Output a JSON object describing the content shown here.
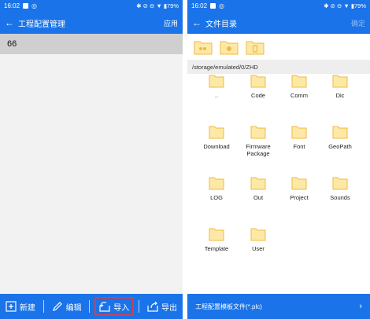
{
  "left": {
    "status": {
      "time": "16:02",
      "right": "✱ ⊘ ⊖ ▼ ▮79%"
    },
    "appbar": {
      "title": "工程配置管理",
      "action": "应用"
    },
    "projects": [
      {
        "name": "66"
      }
    ],
    "toolbar": {
      "new": "新建",
      "edit": "编辑",
      "import": "导入",
      "export": "导出"
    }
  },
  "right": {
    "status": {
      "time": "16:02",
      "right": "✱ ⊘ ⊖ ▼ ▮79%"
    },
    "appbar": {
      "title": "文件目录",
      "action": "确定"
    },
    "path": "/storage/emulated/0/ZHD",
    "folders": [
      {
        "name": ".."
      },
      {
        "name": "Code"
      },
      {
        "name": "Comm"
      },
      {
        "name": "Dic"
      },
      {
        "name": "Download"
      },
      {
        "name": "Firmware Package"
      },
      {
        "name": "Font"
      },
      {
        "name": "GeoPath"
      },
      {
        "name": "LOG"
      },
      {
        "name": "Out"
      },
      {
        "name": "Project"
      },
      {
        "name": "Sounds"
      },
      {
        "name": "Template"
      },
      {
        "name": "User"
      }
    ],
    "filter": "工程配置模板文件(*.plc)"
  },
  "colors": {
    "primary": "#1a73e8",
    "folder": "#fde9a6",
    "folder_stroke": "#f3b840",
    "highlight": "#e53935"
  }
}
